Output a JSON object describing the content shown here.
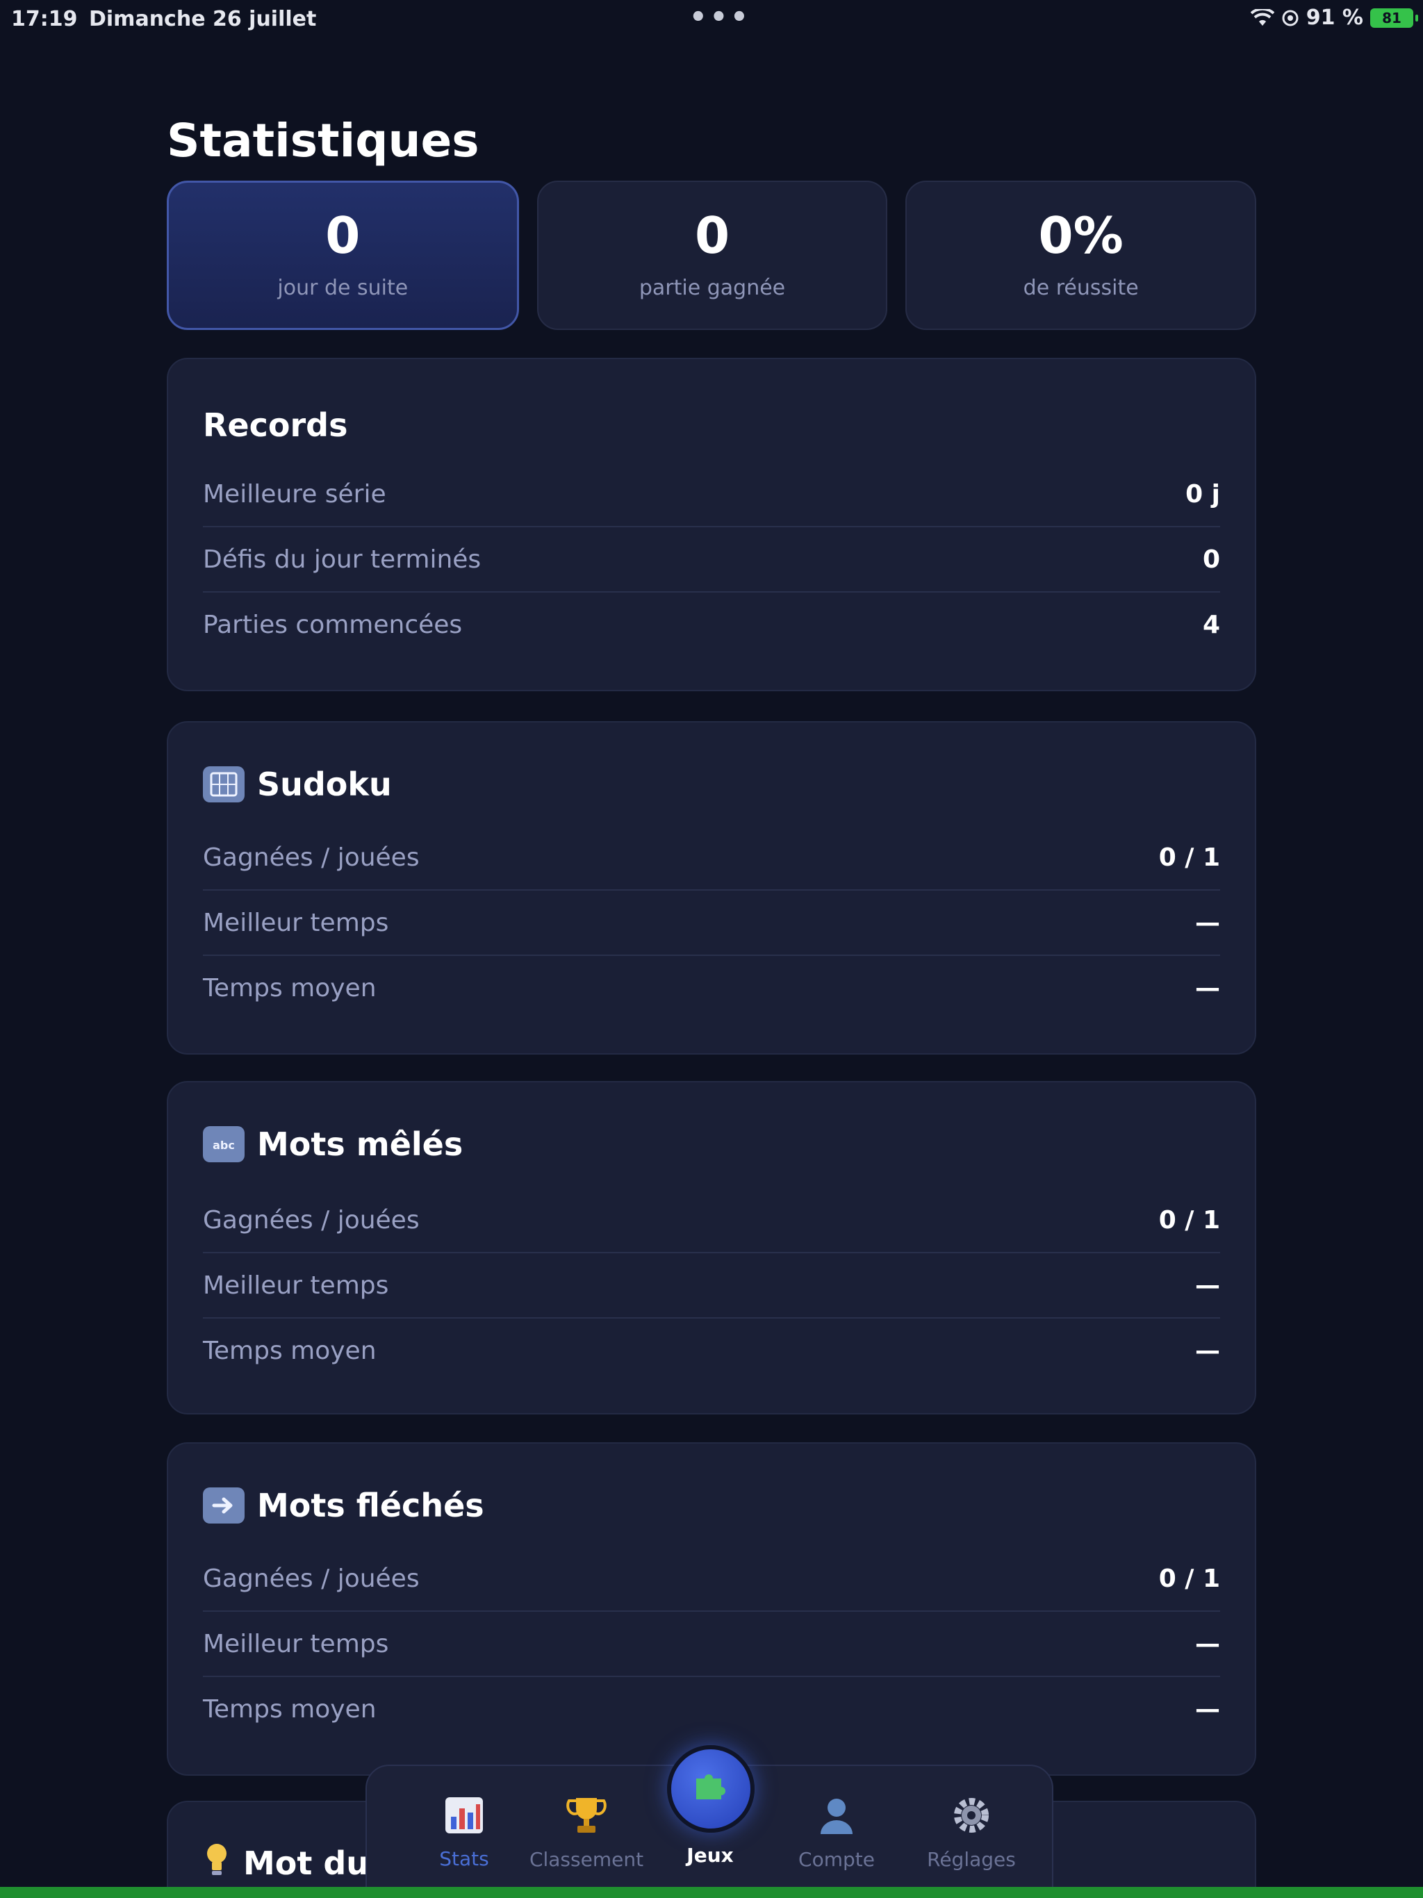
{
  "status_bar": {
    "time": "17:19",
    "date": "Dimanche 26 juillet",
    "battery_percent": "91 %",
    "battery_badge": "81"
  },
  "page": {
    "title": "Statistiques"
  },
  "summary": [
    {
      "value": "0",
      "label": "jour de suite",
      "active": true
    },
    {
      "value": "0",
      "label": "partie gagnée",
      "active": false
    },
    {
      "value": "0%",
      "label": "de réussite",
      "active": false
    }
  ],
  "records": {
    "title": "Records",
    "rows": [
      {
        "label": "Meilleure série",
        "value": "0 j"
      },
      {
        "label": "Défis du jour terminés",
        "value": "0"
      },
      {
        "label": "Parties commencées",
        "value": "4"
      }
    ]
  },
  "games": [
    {
      "title": "Sudoku",
      "icon": "numbers-icon",
      "rows": [
        {
          "label": "Gagnées / jouées",
          "value": "0 / 1"
        },
        {
          "label": "Meilleur temps",
          "value": "—"
        },
        {
          "label": "Temps moyen",
          "value": "—"
        }
      ]
    },
    {
      "title": "Mots mêlés",
      "icon": "abc-icon",
      "rows": [
        {
          "label": "Gagnées / jouées",
          "value": "0 / 1"
        },
        {
          "label": "Meilleur temps",
          "value": "—"
        },
        {
          "label": "Temps moyen",
          "value": "—"
        }
      ]
    },
    {
      "title": "Mots fléchés",
      "icon": "right-arrow-icon",
      "rows": [
        {
          "label": "Gagnées / jouées",
          "value": "0 / 1"
        },
        {
          "label": "Meilleur temps",
          "value": "—"
        },
        {
          "label": "Temps moyen",
          "value": "—"
        }
      ]
    }
  ],
  "partial_card": {
    "title": "Mot du"
  },
  "nav": {
    "items": [
      {
        "label": "Stats",
        "icon": "bar-chart-icon"
      },
      {
        "label": "Classement",
        "icon": "trophy-icon"
      },
      {
        "label": "Jeux",
        "icon": "puzzle-icon"
      },
      {
        "label": "Compte",
        "icon": "user-icon"
      },
      {
        "label": "Réglages",
        "icon": "gear-icon"
      }
    ]
  },
  "colors": {
    "background": "#0d1120",
    "card": "#1a1f36",
    "accent": "#2540b8",
    "muted_text": "#9aa1c4"
  }
}
